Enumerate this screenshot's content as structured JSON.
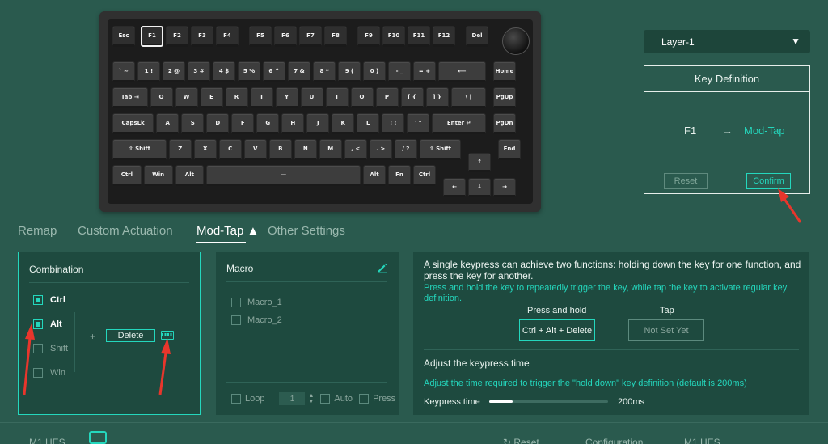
{
  "keyboard": {
    "rows": [
      [
        {
          "k": "Esc"
        },
        {
          "k": "F1",
          "sel": true
        },
        {
          "k": "F2"
        },
        {
          "k": "F3"
        },
        {
          "k": "F4"
        },
        {
          "k": "F5"
        },
        {
          "k": "F6"
        },
        {
          "k": "F7"
        },
        {
          "k": "F8"
        },
        {
          "k": "F9"
        },
        {
          "k": "F10"
        },
        {
          "k": "F11"
        },
        {
          "k": "F12"
        },
        {
          "k": "Del"
        }
      ],
      [
        {
          "k": "` ~"
        },
        {
          "k": "1 !"
        },
        {
          "k": "2 @"
        },
        {
          "k": "3 #"
        },
        {
          "k": "4 $"
        },
        {
          "k": "5 %"
        },
        {
          "k": "6 ^"
        },
        {
          "k": "7 &"
        },
        {
          "k": "8 *"
        },
        {
          "k": "9 ("
        },
        {
          "k": "0 )"
        },
        {
          "k": "- _"
        },
        {
          "k": "= +"
        },
        {
          "k": "⟵"
        },
        {
          "k": "Home"
        }
      ],
      [
        {
          "k": "Tab ⇥"
        },
        {
          "k": "Q"
        },
        {
          "k": "W"
        },
        {
          "k": "E"
        },
        {
          "k": "R"
        },
        {
          "k": "T"
        },
        {
          "k": "Y"
        },
        {
          "k": "U"
        },
        {
          "k": "I"
        },
        {
          "k": "O"
        },
        {
          "k": "P"
        },
        {
          "k": "[ {"
        },
        {
          "k": "] }"
        },
        {
          "k": "\\ |"
        },
        {
          "k": "PgUp"
        }
      ],
      [
        {
          "k": "CapsLk"
        },
        {
          "k": "A"
        },
        {
          "k": "S"
        },
        {
          "k": "D"
        },
        {
          "k": "F"
        },
        {
          "k": "G"
        },
        {
          "k": "H"
        },
        {
          "k": "J"
        },
        {
          "k": "K"
        },
        {
          "k": "L"
        },
        {
          "k": "; :"
        },
        {
          "k": "' \""
        },
        {
          "k": "Enter ↵"
        },
        {
          "k": "PgDn"
        }
      ],
      [
        {
          "k": "⇧ Shift"
        },
        {
          "k": "Z"
        },
        {
          "k": "X"
        },
        {
          "k": "C"
        },
        {
          "k": "V"
        },
        {
          "k": "B"
        },
        {
          "k": "N"
        },
        {
          "k": "M"
        },
        {
          "k": ", <"
        },
        {
          "k": ". >"
        },
        {
          "k": "/ ?"
        },
        {
          "k": "⇧ Shift"
        },
        {
          "k": "↑"
        },
        {
          "k": "End"
        }
      ],
      [
        {
          "k": "Ctrl"
        },
        {
          "k": "Win"
        },
        {
          "k": "Alt"
        },
        {
          "k": "—"
        },
        {
          "k": "Alt"
        },
        {
          "k": "Fn"
        },
        {
          "k": "Ctrl"
        },
        {
          "k": "←"
        },
        {
          "k": "↓"
        },
        {
          "k": "→"
        }
      ]
    ]
  },
  "layer": {
    "selected": "Layer-1",
    "caret": "▼"
  },
  "key_definition": {
    "title": "Key Definition",
    "source_key": "F1",
    "arrow": "→",
    "target": "Mod-Tap",
    "reset_label": "Reset",
    "confirm_label": "Confirm"
  },
  "tabs": [
    {
      "label": "Remap"
    },
    {
      "label": "Custom Actuation"
    },
    {
      "label": "Mod-Tap ▲"
    },
    {
      "label": "Other Settings"
    }
  ],
  "combination": {
    "title": "Combination",
    "modifiers": [
      {
        "label": "Ctrl",
        "checked": true
      },
      {
        "label": "Alt",
        "checked": true
      },
      {
        "label": "Shift",
        "checked": false
      },
      {
        "label": "Win",
        "checked": false
      }
    ],
    "plus": "+",
    "key": "Delete"
  },
  "macro": {
    "title": "Macro",
    "items": [
      {
        "label": "Macro_1"
      },
      {
        "label": "Macro_2"
      }
    ],
    "loop_label": "Loop",
    "count": "1",
    "auto_label": "Auto",
    "press_label": "Press"
  },
  "modtap": {
    "description": "A single keypress can achieve two functions: holding down the key for one function, and press the key for another.",
    "hint": "Press and hold the key to repeatedly trigger the key, while tap the key to activate regular key definition.",
    "hold_header": "Press and hold",
    "tap_header": "Tap",
    "hold_value": "Ctrl + Alt + Delete",
    "tap_value": "Not Set Yet",
    "adjust_title": "Adjust the keypress time",
    "adjust_hint": "Adjust the time required to trigger the \"hold down\" key definition (default is 200ms)",
    "keypress_label": "Keypress time",
    "keypress_value": "200ms",
    "keypress_fraction": 0.2
  },
  "bottom_bar": {
    "device_left": "M1 HES",
    "reset": "↻ Reset",
    "configuration": "Configuration",
    "device_right": "M1 HES"
  },
  "colors": {
    "accent": "#24d7bd",
    "background": "#2a5a4e",
    "panel": "#1e4a3f",
    "arrow": "#e8362c"
  }
}
